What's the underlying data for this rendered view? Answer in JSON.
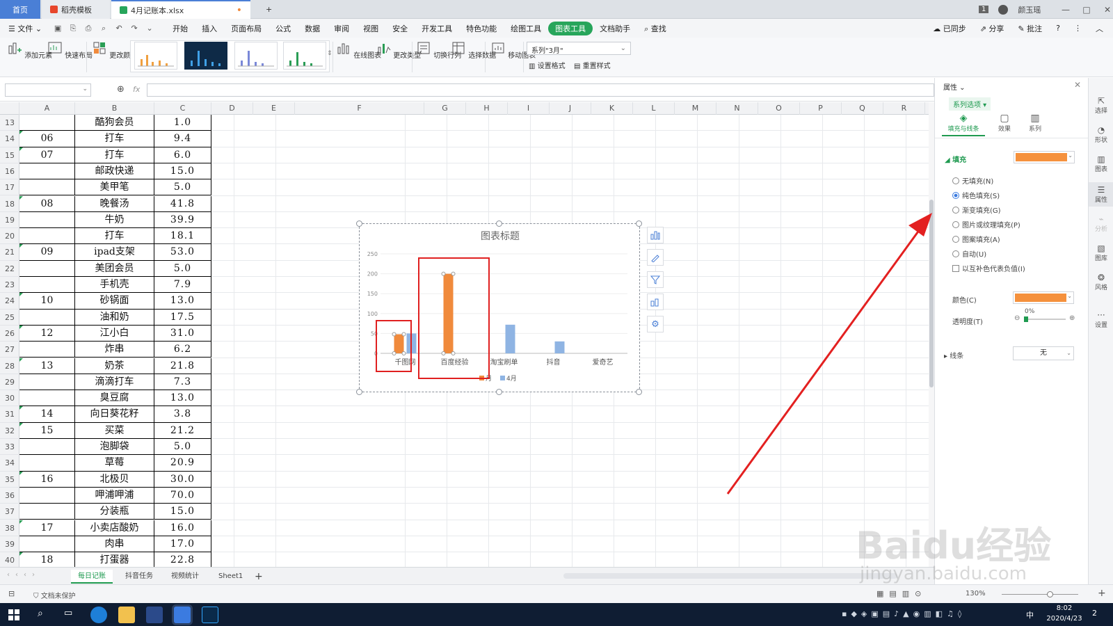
{
  "titlebar": {
    "tabs": [
      {
        "label": "首页"
      },
      {
        "label": "稻壳模板"
      },
      {
        "label": "4月记账本.xlsx"
      }
    ],
    "new_tab": "+",
    "badge": "1",
    "user": "颜玉瑶",
    "win_min": "—",
    "win_max": "□",
    "win_close": "✕"
  },
  "menubar": {
    "file": "文件",
    "items": [
      "开始",
      "插入",
      "页面布局",
      "公式",
      "数据",
      "审阅",
      "视图",
      "安全",
      "开发工具",
      "特色功能",
      "绘图工具",
      "图表工具",
      "文档助手"
    ],
    "active": "图表工具",
    "search": "查找",
    "right": [
      "已同步",
      "分享",
      "批注"
    ]
  },
  "ribbon": {
    "buttons": [
      {
        "label": "添加元素"
      },
      {
        "label": "快速布局"
      },
      {
        "label": "更改颜色"
      },
      {
        "label": "在线图表"
      },
      {
        "label": "更改类型"
      },
      {
        "label": "切换行列"
      },
      {
        "label": "选择数据"
      },
      {
        "label": "移动图表"
      }
    ],
    "series_select": "系列\"3月\"",
    "set_format": "设置格式",
    "reset_style": "重置样式"
  },
  "formula": {
    "fx": "fx"
  },
  "sheet": {
    "columns": [
      "A",
      "B",
      "C",
      "D",
      "E",
      "F",
      "G",
      "H",
      "I",
      "J",
      "K",
      "L",
      "M",
      "N",
      "O",
      "P",
      "Q",
      "R"
    ],
    "rows": [
      {
        "n": "13",
        "a": "",
        "b": "酷狗会员",
        "c": "1.0"
      },
      {
        "n": "14",
        "a": "06",
        "b": "打车",
        "c": "9.4"
      },
      {
        "n": "15",
        "a": "07",
        "b": "打车",
        "c": "6.0"
      },
      {
        "n": "16",
        "a": "",
        "b": "邮政快递",
        "c": "15.0"
      },
      {
        "n": "17",
        "a": "",
        "b": "美甲笔",
        "c": "5.0"
      },
      {
        "n": "18",
        "a": "08",
        "b": "晚餐汤",
        "c": "41.8"
      },
      {
        "n": "19",
        "a": "",
        "b": "牛奶",
        "c": "39.9"
      },
      {
        "n": "20",
        "a": "",
        "b": "打车",
        "c": "18.1"
      },
      {
        "n": "21",
        "a": "09",
        "b": "ipad支架",
        "c": "53.0"
      },
      {
        "n": "22",
        "a": "",
        "b": "美团会员",
        "c": "5.0"
      },
      {
        "n": "23",
        "a": "",
        "b": "手机壳",
        "c": "7.9"
      },
      {
        "n": "24",
        "a": "10",
        "b": "砂锅面",
        "c": "13.0"
      },
      {
        "n": "25",
        "a": "",
        "b": "油和奶",
        "c": "17.5"
      },
      {
        "n": "26",
        "a": "12",
        "b": "江小白",
        "c": "31.0"
      },
      {
        "n": "27",
        "a": "",
        "b": "炸串",
        "c": "6.2"
      },
      {
        "n": "28",
        "a": "13",
        "b": "奶茶",
        "c": "21.8"
      },
      {
        "n": "29",
        "a": "",
        "b": "滴滴打车",
        "c": "7.3"
      },
      {
        "n": "30",
        "a": "",
        "b": "臭豆腐",
        "c": "13.0"
      },
      {
        "n": "31",
        "a": "14",
        "b": "向日葵花籽",
        "c": "3.8"
      },
      {
        "n": "32",
        "a": "15",
        "b": "买菜",
        "c": "21.2"
      },
      {
        "n": "33",
        "a": "",
        "b": "泡脚袋",
        "c": "5.0"
      },
      {
        "n": "34",
        "a": "",
        "b": "草莓",
        "c": "20.9"
      },
      {
        "n": "35",
        "a": "16",
        "b": "北极贝",
        "c": "30.0"
      },
      {
        "n": "36",
        "a": "",
        "b": "呷浦呷浦",
        "c": "70.0"
      },
      {
        "n": "37",
        "a": "",
        "b": "分装瓶",
        "c": "15.0"
      },
      {
        "n": "38",
        "a": "17",
        "b": "小卖店酸奶",
        "c": "16.0"
      },
      {
        "n": "39",
        "a": "",
        "b": "肉串",
        "c": "17.0"
      },
      {
        "n": "40",
        "a": "18",
        "b": "打蛋器",
        "c": "22.8"
      }
    ],
    "tabs": [
      "每日记账",
      "抖音任务",
      "视频统计",
      "Sheet1"
    ],
    "active_tab": "每日记账",
    "add_tab": "+"
  },
  "status": {
    "protect": "文档未保护",
    "zoom": "130%"
  },
  "chart_data": {
    "type": "bar",
    "title": "图表标题",
    "categories": [
      "千图网",
      "百度经验",
      "淘宝刷单",
      "抖音",
      "爱奇艺"
    ],
    "series": [
      {
        "name": "月",
        "color": "#f08a3c",
        "values": [
          48,
          200,
          0,
          0,
          0
        ]
      },
      {
        "name": "4月",
        "color": "#8fb4e3",
        "values": [
          50,
          0,
          72,
          30,
          0
        ]
      }
    ],
    "y_ticks": [
      "0",
      "50",
      "100",
      "150",
      "200",
      "250"
    ],
    "ylim": [
      0,
      250
    ]
  },
  "panel": {
    "header": "属性",
    "series_options": "系列选项",
    "tabs": [
      "填充与线条",
      "效果",
      "系列"
    ],
    "fill_label": "填充",
    "fill_color": "#f5913d",
    "options": [
      "无填充(N)",
      "纯色填充(S)",
      "渐变填充(G)",
      "图片或纹理填充(P)",
      "图案填充(A)",
      "自动(U)"
    ],
    "selected_option": "纯色填充(S)",
    "invert": "以互补色代表负值(I)",
    "color_label": "颜色(C)",
    "transparency_label": "透明度(T)",
    "transparency_value": "0%",
    "line_label": "线条",
    "line_value": "无"
  },
  "sidebar": {
    "items": [
      "选择",
      "形状",
      "图表",
      "属性",
      "分析",
      "图库",
      "风格",
      "设置"
    ]
  },
  "taskbar": {
    "time": "8:02",
    "date": "2020/4/23",
    "ime": "中",
    "notif": "2"
  },
  "watermark": {
    "brand": "Baidu经验",
    "url": "jingyan.baidu.com"
  }
}
